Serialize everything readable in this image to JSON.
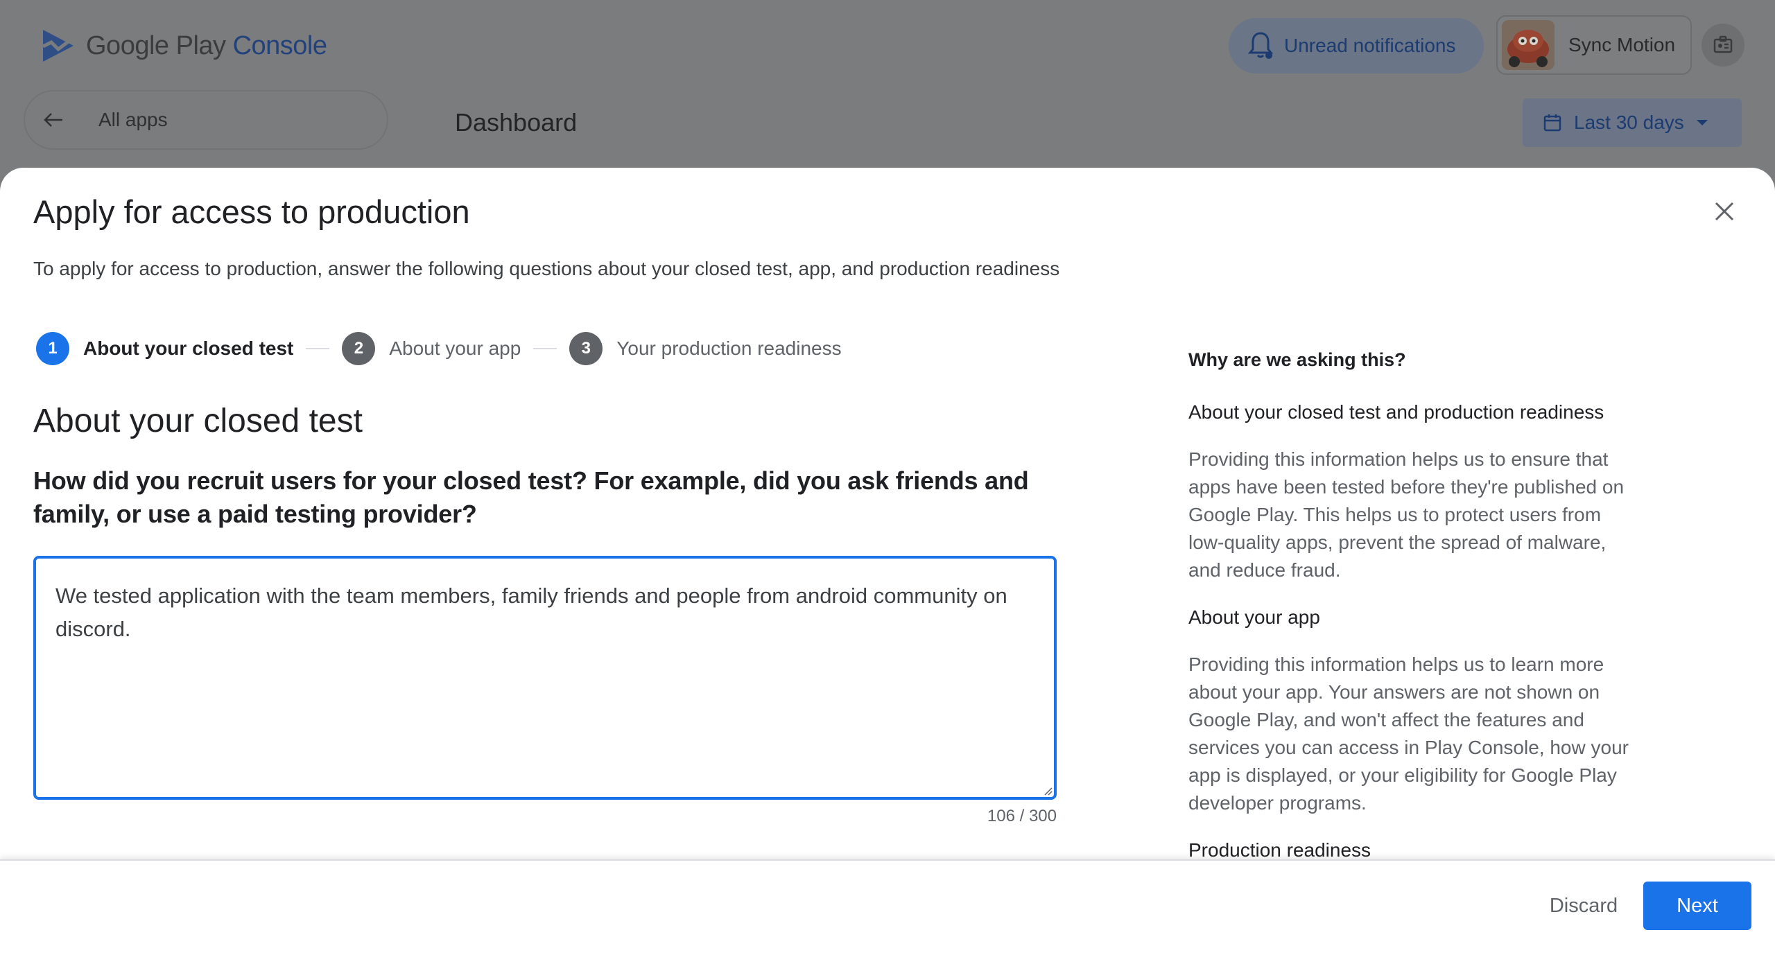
{
  "app": {
    "logo_text_main": "Google Play",
    "logo_text_accent": "Console",
    "notifications_label": "Unread notifications",
    "account_name": "Sync Motion",
    "all_apps_label": "All apps",
    "page_title": "Dashboard",
    "date_range_label": "Last 30 days"
  },
  "modal": {
    "title": "Apply for access to production",
    "subtitle": "To apply for access to production, answer the following questions about your closed test, app, and production readiness",
    "steps": [
      {
        "number": "1",
        "label": "About your closed test",
        "active": true
      },
      {
        "number": "2",
        "label": "About your app",
        "active": false
      },
      {
        "number": "3",
        "label": "Your production readiness",
        "active": false
      }
    ],
    "section_title": "About your closed test",
    "question": "How did you recruit users for your closed test? For example, did you ask friends and family, or use a paid testing provider?",
    "answer": "We tested application with the team members, family friends and people from android community on discord.",
    "char_count": "106 / 300",
    "help": {
      "heading": "Why are we asking this?",
      "sub1": "About your closed test and production readiness",
      "para1": "Providing this information helps us to ensure that apps have been tested before they're published on Google Play. This helps us to protect users from low-quality apps, prevent the spread of malware, and reduce fraud.",
      "sub2": "About your app",
      "para2": "Providing this information helps us to learn more about your app. Your answers are not shown on Google Play, and won't affect the features and services you can access in Play Console, how your app is displayed, or your eligibility for Google Play developer programs.",
      "sub3": "Production readiness"
    },
    "discard_label": "Discard",
    "next_label": "Next"
  },
  "colors": {
    "accent": "#1a73e8",
    "overlay": "#7b7c7e"
  }
}
